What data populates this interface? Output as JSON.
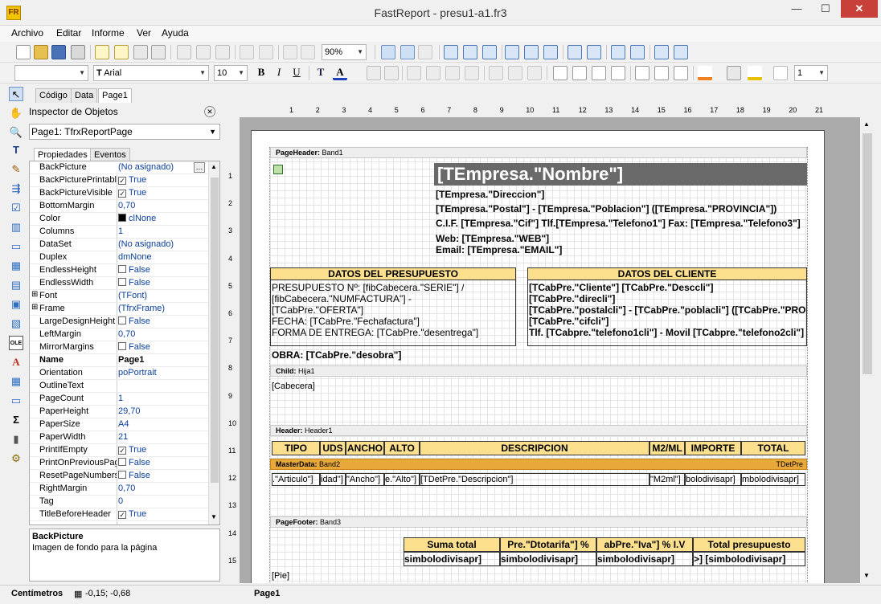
{
  "window": {
    "title": "FastReport - presu1-a1.fr3",
    "app_icon": "FR",
    "minimize": "—",
    "maximize": "☐",
    "close": "✕"
  },
  "menu": [
    "Archivo",
    "Editar",
    "Informe",
    "Ver",
    "Ayuda"
  ],
  "toolbar": {
    "zoom": "90%",
    "font_name": "Arial",
    "font_size": "10",
    "line_width": "1",
    "style_combo": ""
  },
  "editor_tabs": [
    "Código",
    "Data",
    "Page1"
  ],
  "inspector": {
    "title": "Inspector de Objetos",
    "object": "Page1: TfrxReportPage",
    "tabs": [
      "Propiedades",
      "Eventos"
    ],
    "props": [
      {
        "name": "BackPicture",
        "value": "(No asignado)"
      },
      {
        "name": "BackPicturePrintable",
        "value": "True",
        "check": true
      },
      {
        "name": "BackPictureVisible",
        "value": "True",
        "check": true
      },
      {
        "name": "BottomMargin",
        "value": "0,70"
      },
      {
        "name": "Color",
        "value": "clNone",
        "swatch": true
      },
      {
        "name": "Columns",
        "value": "1"
      },
      {
        "name": "DataSet",
        "value": "(No asignado)"
      },
      {
        "name": "Duplex",
        "value": "dmNone"
      },
      {
        "name": "EndlessHeight",
        "value": "False",
        "check": false
      },
      {
        "name": "EndlessWidth",
        "value": "False",
        "check": false
      },
      {
        "name": "Font",
        "value": "(TFont)",
        "expand": true
      },
      {
        "name": "Frame",
        "value": "(TfrxFrame)",
        "expand": true
      },
      {
        "name": "LargeDesignHeight",
        "value": "False",
        "check": false
      },
      {
        "name": "LeftMargin",
        "value": "0,70"
      },
      {
        "name": "MirrorMargins",
        "value": "False",
        "check": false
      },
      {
        "name": "Name",
        "value": "Page1",
        "bold": true
      },
      {
        "name": "Orientation",
        "value": "poPortrait"
      },
      {
        "name": "OutlineText",
        "value": ""
      },
      {
        "name": "PageCount",
        "value": "1"
      },
      {
        "name": "PaperHeight",
        "value": "29,70"
      },
      {
        "name": "PaperSize",
        "value": "A4"
      },
      {
        "name": "PaperWidth",
        "value": "21"
      },
      {
        "name": "PrintIfEmpty",
        "value": "True",
        "check": true
      },
      {
        "name": "PrintOnPreviousPag",
        "value": "False",
        "check": false
      },
      {
        "name": "ResetPageNumbers",
        "value": "False",
        "check": false
      },
      {
        "name": "RightMargin",
        "value": "0,70"
      },
      {
        "name": "Tag",
        "value": "0"
      },
      {
        "name": "TitleBeforeHeader",
        "value": "True",
        "check": true
      }
    ],
    "desc_title": "BackPicture",
    "desc_text": "Imagen de fondo para la página"
  },
  "ruler_h": [
    "1",
    "2",
    "3",
    "4",
    "5",
    "6",
    "7",
    "8",
    "9",
    "10",
    "11",
    "12",
    "13",
    "14",
    "15",
    "16",
    "17",
    "18",
    "19",
    "20",
    "21"
  ],
  "ruler_v": [
    "1",
    "2",
    "3",
    "4",
    "5",
    "6",
    "7",
    "8",
    "9",
    "10",
    "11",
    "12",
    "13",
    "14",
    "15",
    "16"
  ],
  "report": {
    "page_header": {
      "type": "PageHeader:",
      "name": "Band1"
    },
    "title": "[TEmpresa.\"Nombre\"]",
    "company_lines": [
      "[TEmpresa.\"Direccion\"]",
      "[TEmpresa.\"Postal\"] - [TEmpresa.\"Poblacion\"]  ([TEmpresa.\"PROVINCIA\"])",
      "C.I.F. [TEmpresa.\"Cif\"] Tlf.[TEmpresa.\"Telefono1\"] Fax: [TEmpresa.\"Telefono3\"]",
      "Web: [TEmpresa.\"WEB\"]",
      "Email: [TEmpresa.\"EMAIL\"]"
    ],
    "budget_header": "DATOS DEL PRESUPUESTO",
    "budget_lines": [
      "PRESUPUESTO Nº: [fibCabecera.\"SERIE\"] /",
      "[fibCabecera.\"NUMFACTURA\"] -",
      "[TCabPre.\"OFERTA\"]",
      "FECHA: [TCabPre.\"Fechafactura\"]",
      "FORMA DE ENTREGA: [TCabPre.\"desentrega\"]"
    ],
    "client_header": "DATOS DEL CLIENTE",
    "client_lines": [
      "[TCabPre.\"Cliente\"] [TCabPre.\"Desccli\"]",
      "[TCabPre.\"direcli\"]",
      "[TCabPre.\"postalcli\"] - [TCabPre.\"poblacli\"] ([TCabPre.\"PRO",
      "[TCabPre.\"cifcli\"]",
      "Tlf. [TCabpre.\"telefono1cli\"] - Movil  [TCabpre.\"telefono2cli\"]"
    ],
    "obra": "OBRA: [TCabPre.\"desobra\"]",
    "child": {
      "type": "Child:",
      "name": "Hija1",
      "text": "[Cabecera]"
    },
    "header": {
      "type": "Header:",
      "name": "Header1"
    },
    "columns": [
      "TIPO",
      "UDS",
      "ANCHO",
      "ALTO",
      "DESCRIPCION",
      "M2/ML",
      "IMPORTE",
      "TOTAL"
    ],
    "master": {
      "type": "MasterData:",
      "name": "Band2",
      "dataset": "TDetPre"
    },
    "detail_cells": [
      ".\"Articulo\"]",
      "idad\"]",
      "\"Ancho\"]",
      "e.\"Alto\"]",
      "[TDetPre.\"Descripcion\"]",
      "\"M2ml\"]",
      "bolodivisapr]",
      "mbolodivisapr]"
    ],
    "footer": {
      "type": "PageFooter:",
      "name": "Band3",
      "pie": "[Pie]"
    },
    "totals_headers": [
      "Suma total",
      "Pre.\"Dtotarifa\"] %",
      "abPre.\"Iva\"] % I.V",
      "Total presupuesto"
    ],
    "totals_values": [
      "simbolodivisapr]",
      "simbolodivisapr]",
      "simbolodivisapr]",
      ">] [simbolodivisapr]"
    ]
  },
  "status": {
    "units": "Centímetros",
    "coords": "-0,15; -0,68",
    "page": "Page1"
  }
}
